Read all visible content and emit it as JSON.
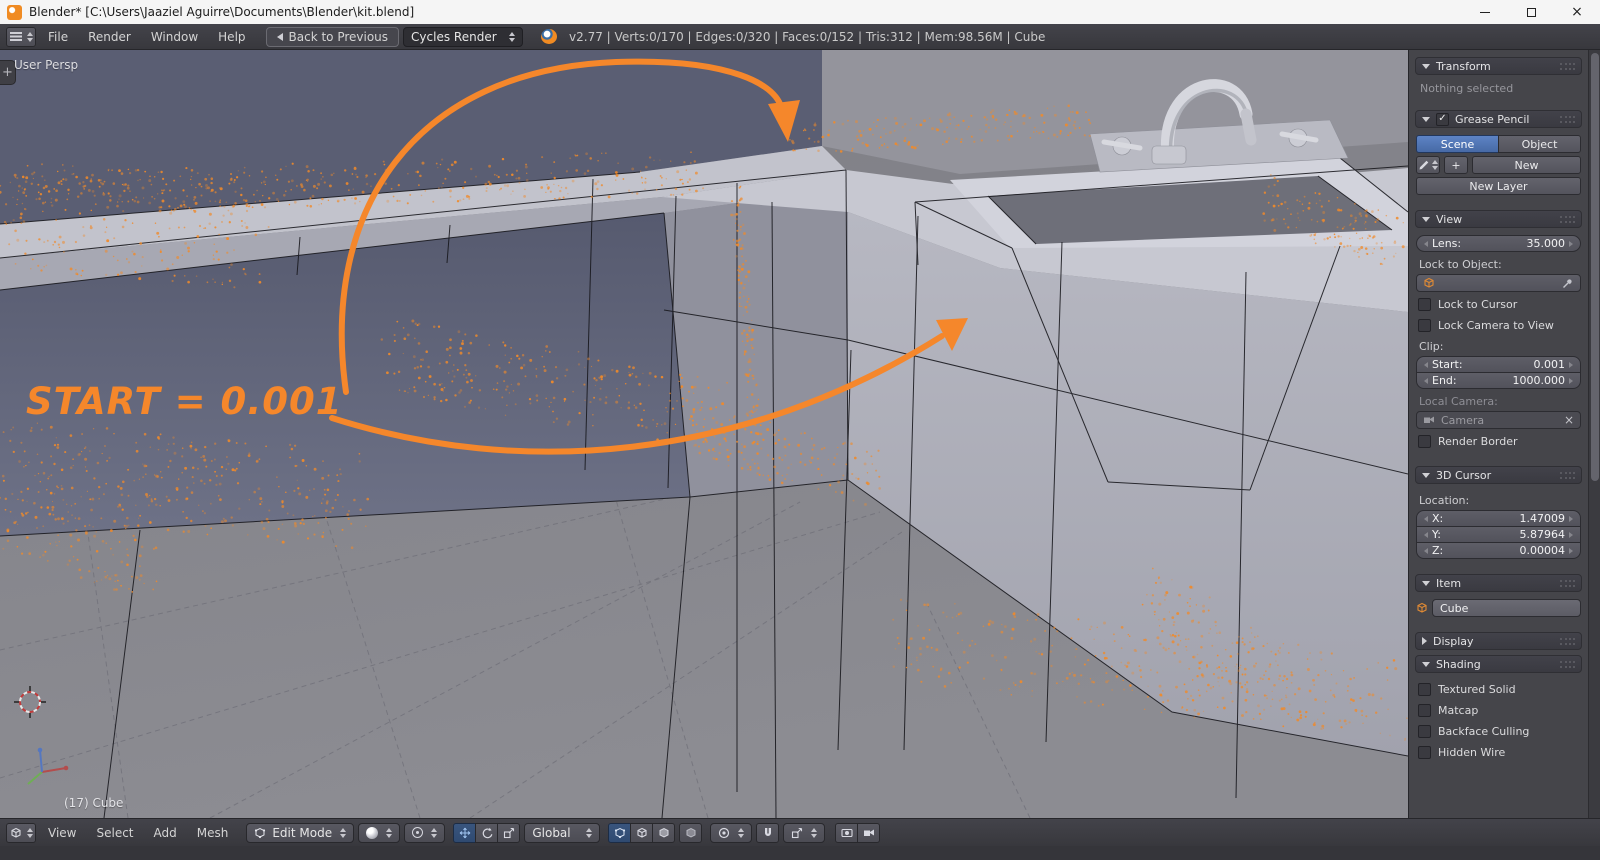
{
  "accent": {
    "orange": "#f5872b",
    "selection_blue": "#4e79b8"
  },
  "icons": {
    "close_x": "×",
    "check": "✓",
    "plus": "+"
  },
  "window": {
    "title": "Blender* [C:\\Users\\Jaaziel Aguirre\\Documents\\Blender\\kit.blend]"
  },
  "topbar": {
    "menus": [
      "File",
      "Render",
      "Window",
      "Help"
    ],
    "back_button": "Back to Previous",
    "engine_select": "Cycles Render",
    "stats": "v2.77 | Verts:0/170 | Edges:0/320 | Faces:0/152 | Tris:312 | Mem:98.56M | Cube"
  },
  "viewport": {
    "view_label": "User Persp",
    "object_info": "(17) Cube",
    "annotation_text": "START = 0.001"
  },
  "sidebar": {
    "transform": {
      "title": "Transform",
      "empty": "Nothing selected"
    },
    "grease_pencil": {
      "title": "Grease Pencil",
      "tab_scene": "Scene",
      "tab_object": "Object",
      "new_button": "New",
      "new_layer_button": "New Layer"
    },
    "view": {
      "title": "View",
      "lens_label": "Lens:",
      "lens_value": "35.000",
      "lock_object_label": "Lock to Object:",
      "lock_cursor": "Lock to Cursor",
      "lock_camera": "Lock Camera to View",
      "clip_label": "Clip:",
      "start_label": "Start:",
      "start_value": "0.001",
      "end_label": "End:",
      "end_value": "1000.000",
      "local_camera_label": "Local Camera:",
      "camera_value": "Camera",
      "render_border": "Render Border"
    },
    "cursor": {
      "title": "3D Cursor",
      "location_label": "Location:",
      "x_label": "X:",
      "x_value": "1.47009",
      "y_label": "Y:",
      "y_value": "5.87964",
      "z_label": "Z:",
      "z_value": "0.00004"
    },
    "item": {
      "title": "Item",
      "name": "Cube"
    },
    "display": {
      "title": "Display"
    },
    "shading": {
      "title": "Shading",
      "opt_textured": "Textured Solid",
      "opt_matcap": "Matcap",
      "opt_backface": "Backface Culling",
      "opt_hidden": "Hidden Wire"
    }
  },
  "bottombar": {
    "menus": [
      "View",
      "Select",
      "Add",
      "Mesh"
    ],
    "mode_select": "Edit Mode",
    "orientation_select": "Global"
  }
}
